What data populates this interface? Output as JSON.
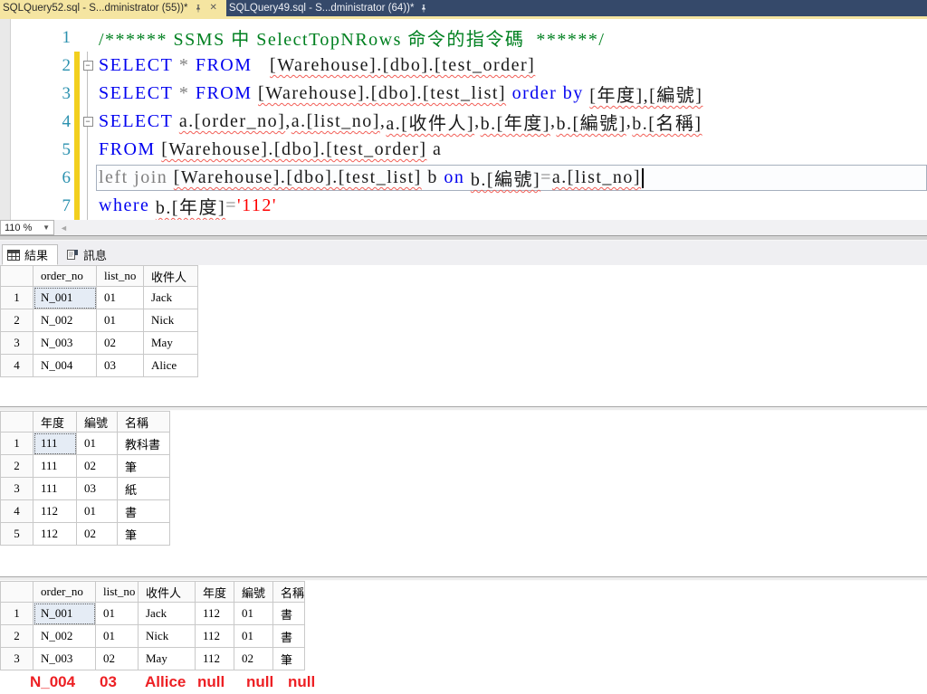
{
  "tabs": [
    {
      "label": "SQLQuery52.sql - S...dministrator (55))*",
      "active": true
    },
    {
      "label": "SQLQuery49.sql - S...dministrator (64))*",
      "active": false
    }
  ],
  "colors": {
    "active_tab_yellow": "#F5E5A1",
    "tabstrip_navy": "#35496A",
    "keyword_blue": "#0000F0",
    "comment_green": "#008020",
    "string_red": "#FF0000",
    "line_number_teal": "#2B91AF",
    "annotation_red": "#ED2024",
    "selected_cell_blue": "#E5ECF5"
  },
  "editor": {
    "zoom_level": "110 %",
    "lines": [
      {
        "num": "1",
        "changed": false,
        "fold": "none",
        "tokens": [
          {
            "t": "/****** SSMS 中 SelectTopNRows 命令的指令碼  ******/",
            "c": "cm"
          }
        ]
      },
      {
        "num": "2",
        "changed": true,
        "fold": "minus",
        "tokens": [
          {
            "t": "SELECT",
            "c": "kw"
          },
          {
            "t": " "
          },
          {
            "t": "*",
            "c": "op"
          },
          {
            "t": " "
          },
          {
            "t": "FROM",
            "c": "kw"
          },
          {
            "t": "   "
          },
          {
            "t": "[Warehouse].[dbo].[test_order]",
            "c": "id",
            "sq": true
          }
        ]
      },
      {
        "num": "3",
        "changed": true,
        "fold": "vline",
        "tokens": [
          {
            "t": "SELECT",
            "c": "kw"
          },
          {
            "t": " "
          },
          {
            "t": "*",
            "c": "op"
          },
          {
            "t": " "
          },
          {
            "t": "FROM",
            "c": "kw"
          },
          {
            "t": " "
          },
          {
            "t": "[Warehouse].[dbo].[test_list]",
            "c": "id",
            "sq": true
          },
          {
            "t": " "
          },
          {
            "t": "order by",
            "c": "kw"
          },
          {
            "t": " "
          },
          {
            "t": "[年度],[編號]",
            "c": "id",
            "sq": true
          }
        ]
      },
      {
        "num": "4",
        "changed": true,
        "fold": "minus",
        "tokens": [
          {
            "t": "SELECT",
            "c": "kw"
          },
          {
            "t": " "
          },
          {
            "t": "a.[order_no]",
            "c": "id",
            "sq": true
          },
          {
            "t": ","
          },
          {
            "t": "a.[list_no]",
            "c": "id",
            "sq": true
          },
          {
            "t": ","
          },
          {
            "t": "a.[收件人]",
            "c": "id",
            "sq": true
          },
          {
            "t": ","
          },
          {
            "t": "b.[年度]",
            "c": "id",
            "sq": true
          },
          {
            "t": ","
          },
          {
            "t": "b.[編號]",
            "c": "id",
            "sq": true
          },
          {
            "t": ","
          },
          {
            "t": "b.[名稱]",
            "c": "id",
            "sq": true
          }
        ]
      },
      {
        "num": "5",
        "changed": true,
        "fold": "vline",
        "tokens": [
          {
            "t": "FROM",
            "c": "kw"
          },
          {
            "t": " "
          },
          {
            "t": "[Warehouse].[dbo].[test_order]",
            "c": "id",
            "sq": true
          },
          {
            "t": " a"
          }
        ]
      },
      {
        "num": "6",
        "changed": true,
        "fold": "vline",
        "current": true,
        "caret": true,
        "tokens": [
          {
            "t": "left join",
            "c": "op"
          },
          {
            "t": " "
          },
          {
            "t": "[Warehouse].[dbo].[test_list]",
            "c": "id",
            "sq": true
          },
          {
            "t": " b "
          },
          {
            "t": "on",
            "c": "kw"
          },
          {
            "t": " "
          },
          {
            "t": "b.[編號]",
            "c": "id",
            "sq": true
          },
          {
            "t": "=",
            "c": "op"
          },
          {
            "t": "a.[list_no]",
            "c": "id",
            "sq": true
          }
        ]
      },
      {
        "num": "7",
        "changed": true,
        "fold": "vline",
        "tokens": [
          {
            "t": "where",
            "c": "kw"
          },
          {
            "t": " "
          },
          {
            "t": "b.[年度]",
            "c": "id",
            "sq": true
          },
          {
            "t": "=",
            "c": "op"
          },
          {
            "t": "'112'",
            "c": "str"
          }
        ]
      }
    ]
  },
  "results": {
    "tabs": [
      {
        "label": "結果",
        "icon": "results-grid-icon",
        "active": true
      },
      {
        "label": "訊息",
        "icon": "messages-icon",
        "active": false
      }
    ],
    "grids": [
      {
        "columns": [
          "order_no",
          "list_no",
          "收件人"
        ],
        "rows": [
          [
            "N_001",
            "01",
            "Jack"
          ],
          [
            "N_002",
            "01",
            "Nick"
          ],
          [
            "N_003",
            "02",
            "May"
          ],
          [
            "N_004",
            "03",
            "Alice"
          ]
        ]
      },
      {
        "columns": [
          "年度",
          "編號",
          "名稱"
        ],
        "rows": [
          [
            "111",
            "01",
            "教科書"
          ],
          [
            "111",
            "02",
            "筆"
          ],
          [
            "111",
            "03",
            "紙"
          ],
          [
            "112",
            "01",
            "書"
          ],
          [
            "112",
            "02",
            "筆"
          ]
        ]
      },
      {
        "columns": [
          "order_no",
          "list_no",
          "收件人",
          "年度",
          "編號",
          "名稱"
        ],
        "rows": [
          [
            "N_001",
            "01",
            "Jack",
            "112",
            "01",
            "書"
          ],
          [
            "N_002",
            "01",
            "Nick",
            "112",
            "01",
            "書"
          ],
          [
            "N_003",
            "02",
            "May",
            "112",
            "02",
            "筆"
          ]
        ]
      }
    ],
    "annotation": {
      "values": [
        "N_004",
        "03",
        "Allice",
        "null",
        "null",
        "null"
      ]
    }
  }
}
